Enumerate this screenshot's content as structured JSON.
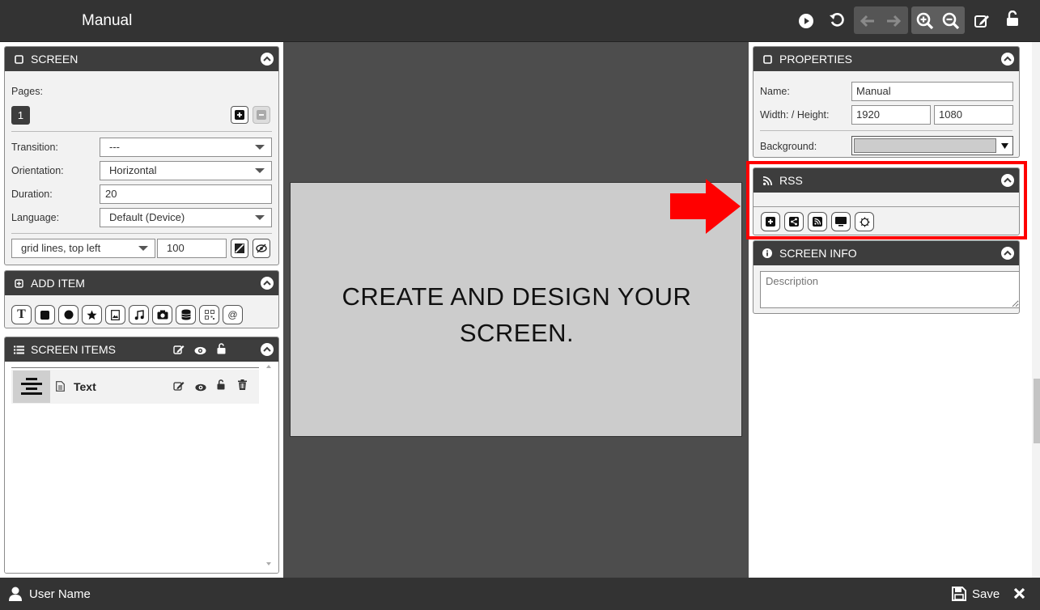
{
  "app": {
    "title": "Manual"
  },
  "toolbar": {
    "icons": [
      "play-icon",
      "undo-icon",
      "arrow-left-icon",
      "arrow-right-icon",
      "zoom-in-icon",
      "zoom-out-icon",
      "edit-icon",
      "unlock-icon"
    ]
  },
  "screen_panel": {
    "title": "SCREEN",
    "pages_label": "Pages:",
    "page_number": "1",
    "transition_label": "Transition:",
    "transition_value": "---",
    "orientation_label": "Orientation:",
    "orientation_value": "Horizontal",
    "duration_label": "Duration:",
    "duration_value": "20",
    "language_label": "Language:",
    "language_value": "Default (Device)",
    "grid_value": "grid lines, top left",
    "grid_size_value": "100"
  },
  "add_item_panel": {
    "title": "ADD ITEM",
    "tools": [
      "text-icon",
      "square-icon",
      "circle-icon",
      "star-icon",
      "image-icon",
      "music-icon",
      "camera-icon",
      "database-icon",
      "qrcode-icon",
      "at-icon"
    ]
  },
  "screen_items_panel": {
    "title": "SCREEN ITEMS",
    "items": [
      {
        "label": "Text"
      }
    ]
  },
  "canvas": {
    "line1": "CREATE AND DESIGN YOUR",
    "line2": "SCREEN."
  },
  "properties_panel": {
    "title": "PROPERTIES",
    "name_label": "Name:",
    "name_value": "Manual",
    "size_label": "Width: / Height:",
    "width_value": "1920",
    "height_value": "1080",
    "background_label": "Background:",
    "background_color": "#cccccc"
  },
  "rss_panel": {
    "title": "RSS",
    "tools": [
      "add-icon",
      "share-icon",
      "rss-icon",
      "monitor-icon",
      "settings-icon"
    ]
  },
  "screen_info_panel": {
    "title": "SCREEN INFO",
    "description_placeholder": "Description"
  },
  "footer": {
    "user_name": "User Name",
    "save_label": "Save"
  },
  "colors": {
    "highlight": "#ff0000",
    "header": "#3d3d3d",
    "topbar": "#333333"
  }
}
